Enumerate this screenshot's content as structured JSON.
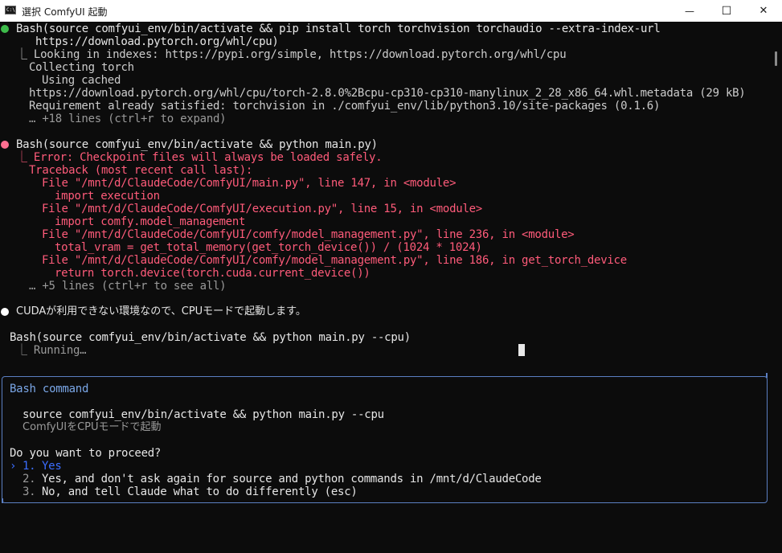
{
  "window": {
    "title": "選択 ComfyUI 起動",
    "icon_label": "C:\\",
    "minimize_glyph": "—",
    "maximize_glyph": "☐",
    "close_glyph": "✕"
  },
  "colors": {
    "success_bullet": "#3dbb4a",
    "error_bullet": "#ff6f91",
    "info_bullet": "#ffffff",
    "error_text": "#ff5b7a",
    "dialog_border": "#5b7fc2",
    "selected_option": "#3b6dff"
  },
  "block1": {
    "command_1": "Bash(source comfyui_env/bin/activate && pip install torch torchvision torchaudio --extra-index-url",
    "command_2": "https://download.pytorch.org/whl/cpu)",
    "out_1": "⎿ Looking in indexes: https://pypi.org/simple, https://download.pytorch.org/whl/cpu",
    "out_2": "Collecting torch",
    "out_3": "Using cached",
    "out_4": "https://download.pytorch.org/whl/cpu/torch-2.8.0%2Bcpu-cp310-cp310-manylinux_2_28_x86_64.whl.metadata (29 kB)",
    "out_5": "Requirement already satisfied: torchvision in ./comfyui_env/lib/python3.10/site-packages (0.1.6)",
    "more": "… +18 lines (ctrl+r to expand)"
  },
  "block2": {
    "command": "Bash(source comfyui_env/bin/activate && python main.py)",
    "e1": "⎿ Error: Checkpoint files will always be loaded safely.",
    "e2": "Traceback (most recent call last):",
    "e3": "File \"/mnt/d/ClaudeCode/ComfyUI/main.py\", line 147, in <module>",
    "e4": "import execution",
    "e5": "File \"/mnt/d/ClaudeCode/ComfyUI/execution.py\", line 15, in <module>",
    "e6": "import comfy.model_management",
    "e7": "File \"/mnt/d/ClaudeCode/ComfyUI/comfy/model_management.py\", line 236, in <module>",
    "e8": "total_vram = get_total_memory(get_torch_device()) / (1024 * 1024)",
    "e9": "File \"/mnt/d/ClaudeCode/ComfyUI/comfy/model_management.py\", line 186, in get_torch_device",
    "e10": "return torch.device(torch.cuda.current_device())",
    "more": "… +5 lines (ctrl+r to see all)"
  },
  "message": "CUDAが利用できない環境なので、CPUモードで起動します。",
  "block3": {
    "command": "Bash(source comfyui_env/bin/activate && python main.py --cpu)",
    "status": "⎿ Running…"
  },
  "dialog": {
    "title": "Bash command",
    "command": "source comfyui_env/bin/activate && python main.py --cpu",
    "description": "ComfyUIをCPUモードで起動",
    "question": "Do you want to proceed?",
    "pointer": "›",
    "options": [
      {
        "num": "1.",
        "label": "Yes"
      },
      {
        "num": "2.",
        "label": "Yes, and don't ask again for source and python commands in /mnt/d/ClaudeCode"
      },
      {
        "num": "3.",
        "label": "No, and tell Claude what to do differently (esc)"
      }
    ]
  }
}
